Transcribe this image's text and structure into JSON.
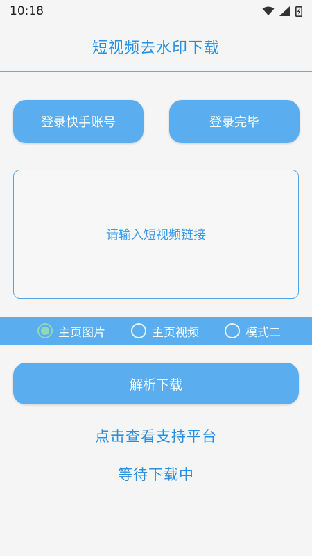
{
  "status_bar": {
    "time": "10:18"
  },
  "header": {
    "title": "短视频去水印下载"
  },
  "buttons": {
    "login_label": "登录快手账号",
    "login_done_label": "登录完毕",
    "parse_label": "解析下载"
  },
  "link_input": {
    "placeholder": "请输入短视频链接"
  },
  "radio_options": [
    {
      "label": "主页图片",
      "checked": true
    },
    {
      "label": "主页视频",
      "checked": false
    },
    {
      "label": "模式二",
      "checked": false
    }
  ],
  "links": {
    "view_platforms": "点击查看支持平台",
    "status": "等待下载中"
  },
  "colors": {
    "accent": "#5aaef0",
    "title_text": "#2b8fe0",
    "radio_checked": "#8fd9b8"
  }
}
